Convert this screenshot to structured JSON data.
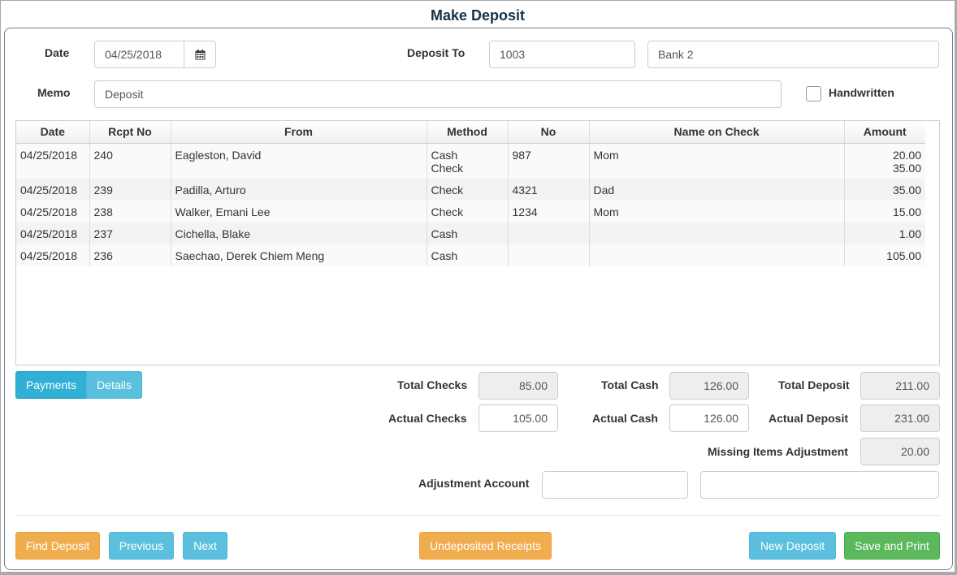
{
  "window": {
    "title": "Make Deposit"
  },
  "header": {
    "date_label": "Date",
    "date_value": "04/25/2018",
    "deposit_to_label": "Deposit To",
    "deposit_to_number": "1003",
    "deposit_to_name": "Bank 2",
    "memo_label": "Memo",
    "memo_value": "Deposit",
    "handwritten_label": "Handwritten"
  },
  "table": {
    "columns": [
      "Date",
      "Rcpt No",
      "From",
      "Method",
      "No",
      "Name on Check",
      "Amount"
    ],
    "rows": [
      {
        "date": "04/25/2018",
        "rcpt": "240",
        "from": "Eagleston, David",
        "method": [
          "Cash",
          "Check"
        ],
        "no": "987",
        "name": "Mom",
        "amount": [
          "20.00",
          "35.00"
        ]
      },
      {
        "date": "04/25/2018",
        "rcpt": "239",
        "from": "Padilla, Arturo",
        "method": [
          "Check"
        ],
        "no": "4321",
        "name": "Dad",
        "amount": [
          "35.00"
        ]
      },
      {
        "date": "04/25/2018",
        "rcpt": "238",
        "from": "Walker, Emani Lee",
        "method": [
          "Check"
        ],
        "no": "1234",
        "name": "Mom",
        "amount": [
          "15.00"
        ]
      },
      {
        "date": "04/25/2018",
        "rcpt": "237",
        "from": "Cichella, Blake",
        "method": [
          "Cash"
        ],
        "no": "",
        "name": "",
        "amount": [
          "1.00"
        ]
      },
      {
        "date": "04/25/2018",
        "rcpt": "236",
        "from": "Saechao, Derek Chiem Meng",
        "method": [
          "Cash"
        ],
        "no": "",
        "name": "",
        "amount": [
          "105.00"
        ]
      }
    ]
  },
  "tabs": {
    "payments": "Payments",
    "details": "Details"
  },
  "totals": {
    "total_checks_label": "Total Checks",
    "total_checks": "85.00",
    "total_cash_label": "Total Cash",
    "total_cash": "126.00",
    "total_deposit_label": "Total Deposit",
    "total_deposit": "211.00",
    "actual_checks_label": "Actual Checks",
    "actual_checks": "105.00",
    "actual_cash_label": "Actual Cash",
    "actual_cash": "126.00",
    "actual_deposit_label": "Actual Deposit",
    "actual_deposit": "231.00",
    "missing_label": "Missing Items Adjustment",
    "missing": "20.00",
    "adjustment_account_label": "Adjustment Account",
    "adjustment_account_code": "",
    "adjustment_account_name": ""
  },
  "footer": {
    "find_deposit": "Find Deposit",
    "previous": "Previous",
    "next": "Next",
    "undeposited": "Undeposited Receipts",
    "new_deposit": "New Deposit",
    "save_print": "Save and Print"
  },
  "icons": {
    "calendar": "calendar-icon"
  },
  "colors": {
    "primary_info": "#5bc0de",
    "warning": "#f0ad4e",
    "success": "#5cb85c",
    "title": "#163248"
  }
}
